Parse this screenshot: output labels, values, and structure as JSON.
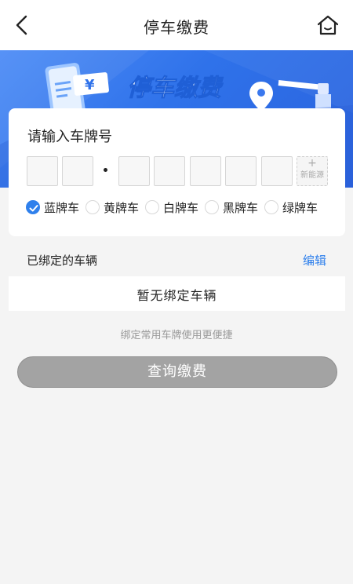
{
  "header": {
    "title": "停车缴费"
  },
  "banner": {
    "text": "停车缴费",
    "currency_symbol": "¥"
  },
  "plate_card": {
    "title": "请输入车牌号",
    "new_energy": {
      "plus": "+",
      "label": "新能源"
    },
    "plate_types": [
      {
        "label": "蓝牌车",
        "checked": true
      },
      {
        "label": "黄牌车",
        "checked": false
      },
      {
        "label": "白牌车",
        "checked": false
      },
      {
        "label": "黑牌车",
        "checked": false
      },
      {
        "label": "绿牌车",
        "checked": false
      }
    ]
  },
  "bound_vehicles": {
    "label": "已绑定的车辆",
    "edit_label": "编辑",
    "empty_text": "暂无绑定车辆",
    "hint": "绑定常用车牌使用更便捷"
  },
  "actions": {
    "query_label": "查询缴费"
  },
  "colors": {
    "accent": "#2f80ec",
    "banner": "#3a78ee",
    "button_disabled": "#a3a3a3"
  }
}
